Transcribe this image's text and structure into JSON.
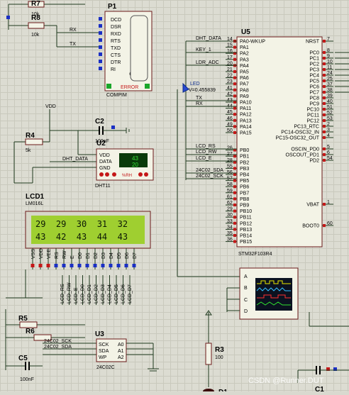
{
  "components": {
    "r7": {
      "ref": "R7",
      "value": "10k"
    },
    "r8": {
      "ref": "R8",
      "value": "10k"
    },
    "p1": {
      "ref": "P1",
      "type": "COMPIM",
      "pins": [
        "DCD",
        "DSR",
        "RXD",
        "RTS",
        "TXD",
        "CTS",
        "DTR",
        "RI"
      ],
      "error": "ERROR"
    },
    "r4": {
      "ref": "R4",
      "value": "5k"
    },
    "c2": {
      "ref": "C2",
      "value": "100nF"
    },
    "u2": {
      "ref": "U2",
      "type": "DHT11",
      "pins": [
        "VDD",
        "DATA",
        "GND"
      ],
      "temp": "43",
      "hum": "20",
      "rh": "%RH"
    },
    "lcd1": {
      "ref": "LCD1",
      "type": "LM016L",
      "row1": "29  29  30  31  32",
      "row2": "43  42  43  44  43",
      "pins": [
        "VSS",
        "VDD",
        "VEE",
        "RS",
        "RW",
        "E",
        "D0",
        "D1",
        "D2",
        "D3",
        "D4",
        "D5",
        "D6",
        "D7"
      ]
    },
    "u5": {
      "ref": "U5",
      "type": "STM32F103R4",
      "left_pins": [
        "PA0-WKUP",
        "PA1",
        "PA2",
        "PA3",
        "PA4",
        "PA5",
        "PA6",
        "PA7",
        "PA8",
        "PA9",
        "PA10",
        "PA11",
        "PA12",
        "PA13",
        "PA14",
        "PA15",
        "PB0",
        "PB1",
        "PB2",
        "PB3",
        "PB4",
        "PB5",
        "PB6",
        "PB7",
        "PB8",
        "PB9",
        "PB10",
        "PB11",
        "PB12",
        "PB13",
        "PB14",
        "PB15"
      ],
      "left_nums": [
        "14",
        "15",
        "16",
        "17",
        "20",
        "21",
        "22",
        "23",
        "41",
        "42",
        "43",
        "44",
        "45",
        "46",
        "49",
        "50",
        "26",
        "27",
        "28",
        "55",
        "56",
        "57",
        "58",
        "59",
        "61",
        "62",
        "29",
        "30",
        "33",
        "34",
        "35",
        "36"
      ],
      "right_pins": [
        "NRST",
        "PC0",
        "PC1",
        "PC2",
        "PC3",
        "PC4",
        "PC5",
        "PC6",
        "PC7",
        "PC8",
        "PC9",
        "PC10",
        "PC11",
        "PC12",
        "PC13_RTC",
        "PC14-OSC32_IN",
        "PC15-OSC32_OUT",
        "OSCIN_PD0",
        "OSCOUT_PD1",
        "PD2",
        "VBAT",
        "BOOT0"
      ],
      "right_nums": [
        "7",
        "8",
        "9",
        "10",
        "11",
        "24",
        "25",
        "37",
        "38",
        "39",
        "40",
        "51",
        "52",
        "53",
        "2",
        "3",
        "4",
        "5",
        "6",
        "54",
        "1",
        "60"
      ]
    },
    "u3": {
      "ref": "U3",
      "type": "24C02C",
      "pins_left": [
        "SCK",
        "SDA",
        "WP"
      ],
      "pins_right": [
        "A0",
        "A1",
        "A2"
      ],
      "nums_left": [
        "6",
        "5",
        "7"
      ],
      "nums_right": [
        "1",
        "2",
        "3"
      ]
    },
    "r5": {
      "ref": "R5"
    },
    "r6": {
      "ref": "R6"
    },
    "c5": {
      "ref": "C5",
      "value": "100nF"
    },
    "r3": {
      "ref": "R3",
      "value": "100"
    },
    "c1": {
      "ref": "C1"
    },
    "d1": {
      "ref": "D1"
    },
    "scope": {
      "channels": [
        "A",
        "B",
        "C",
        "D"
      ]
    }
  },
  "nets": {
    "dht_data": "DHT_DATA",
    "key1": "KEY_1",
    "ldr_adc": "LDR_ADC",
    "tx": "TX",
    "rx": "RX",
    "lcd_rs": "LCD_RS",
    "lcd_rw": "LCD_RW",
    "lcd_e": "LCD_E",
    "sda": "24C02_SDA",
    "sck": "24C02_SCK",
    "vdd": "VDD",
    "led": "LED",
    "led_v": "V=0.455839",
    "lcd_bus": [
      "LCD_RS",
      "LCD_RW",
      "LCD_E",
      "LCD_D0",
      "LCD_D1",
      "LCD_D2",
      "LCD_D3",
      "LCD_D4",
      "LCD_D5",
      "LCD_D6",
      "LCD_D7"
    ]
  },
  "watermark": "CSDN @Runner.DUT"
}
